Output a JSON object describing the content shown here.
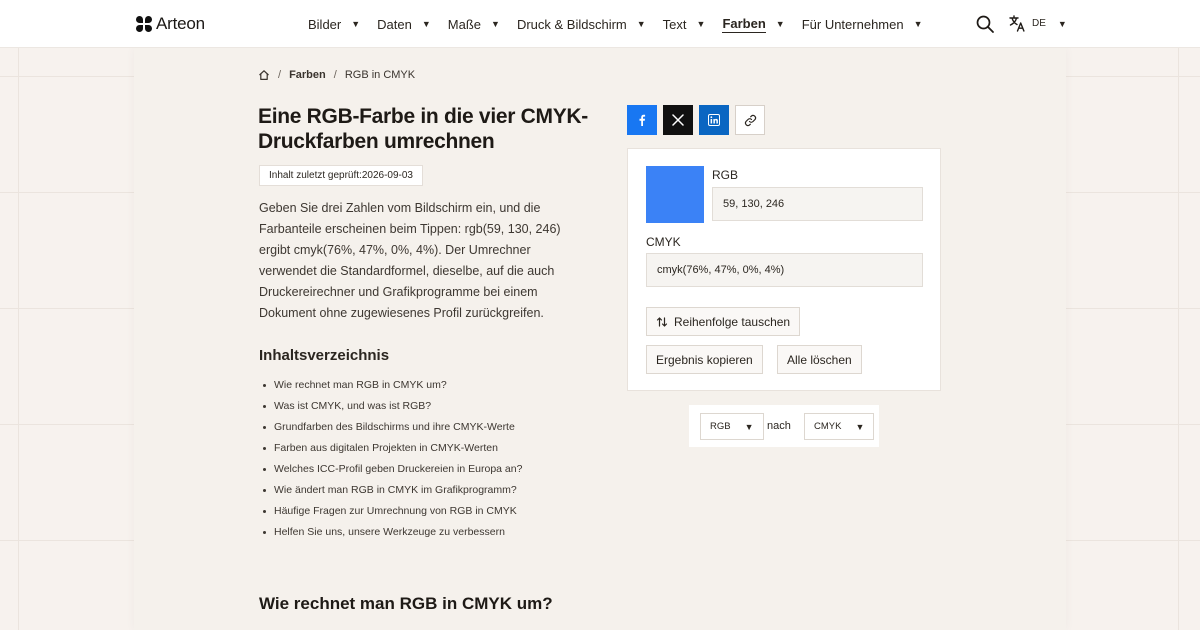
{
  "brand": {
    "name": "Arteon"
  },
  "nav": {
    "items": [
      {
        "label": "Bilder",
        "active": false
      },
      {
        "label": "Daten",
        "active": false
      },
      {
        "label": "Maße",
        "active": false
      },
      {
        "label": "Druck & Bildschirm",
        "active": false
      },
      {
        "label": "Text",
        "active": false
      },
      {
        "label": "Farben",
        "active": true
      },
      {
        "label": "Für Unternehmen",
        "active": false
      }
    ],
    "language": "DE"
  },
  "breadcrumb": {
    "section": "Farben",
    "current": "RGB in CMYK"
  },
  "article": {
    "title": "Eine RGB-Farbe in die vier CMYK-Druckfarben umrechnen",
    "checked_label": "Inhalt zuletzt geprüft:",
    "checked_date": "2026-09-03",
    "intro": "Geben Sie drei Zahlen vom Bildschirm ein, und die Farbanteile erscheinen beim Tippen: rgb(59, 130, 246) ergibt cmyk(76%, 47%, 0%, 4%). Der Umrechner verwendet die Standardformel, dieselbe, auf die auch Druckereirechner und Grafikprogramme bei einem Dokument ohne zugewiesenes Profil zurückgreifen.",
    "toc_heading": "Inhaltsverzeichnis",
    "toc": [
      "Wie rechnet man RGB in CMYK um?",
      "Was ist CMYK, und was ist RGB?",
      "Grundfarben des Bildschirms und ihre CMYK-Werte",
      "Farben aus digitalen Projekten in CMYK-Werten",
      "Welches ICC-Profil geben Druckereien in Europa an?",
      "Wie ändert man RGB in CMYK im Grafikprogramm?",
      "Häufige Fragen zur Umrechnung von RGB in CMYK",
      "Helfen Sie uns, unsere Werkzeuge zu verbessern"
    ],
    "section_heading": "Wie rechnet man RGB in CMYK um?"
  },
  "share": {
    "icons": [
      "facebook-icon",
      "x-icon",
      "linkedin-icon",
      "link-icon"
    ],
    "colors": {
      "facebook": "#1877f2",
      "x": "#111111",
      "linkedin": "#0a66c2"
    }
  },
  "converter": {
    "swatch_color": "#3b82f6",
    "rgb_label": "RGB",
    "rgb_value": "59, 130, 246",
    "cmyk_label": "CMYK",
    "cmyk_value": "cmyk(76%, 47%, 0%, 4%)",
    "swap_label": "Reihenfolge tauschen",
    "copy_label": "Ergebnis kopieren",
    "clear_label": "Alle löschen"
  },
  "direction": {
    "from": "RGB",
    "word": "nach",
    "to": "CMYK"
  }
}
